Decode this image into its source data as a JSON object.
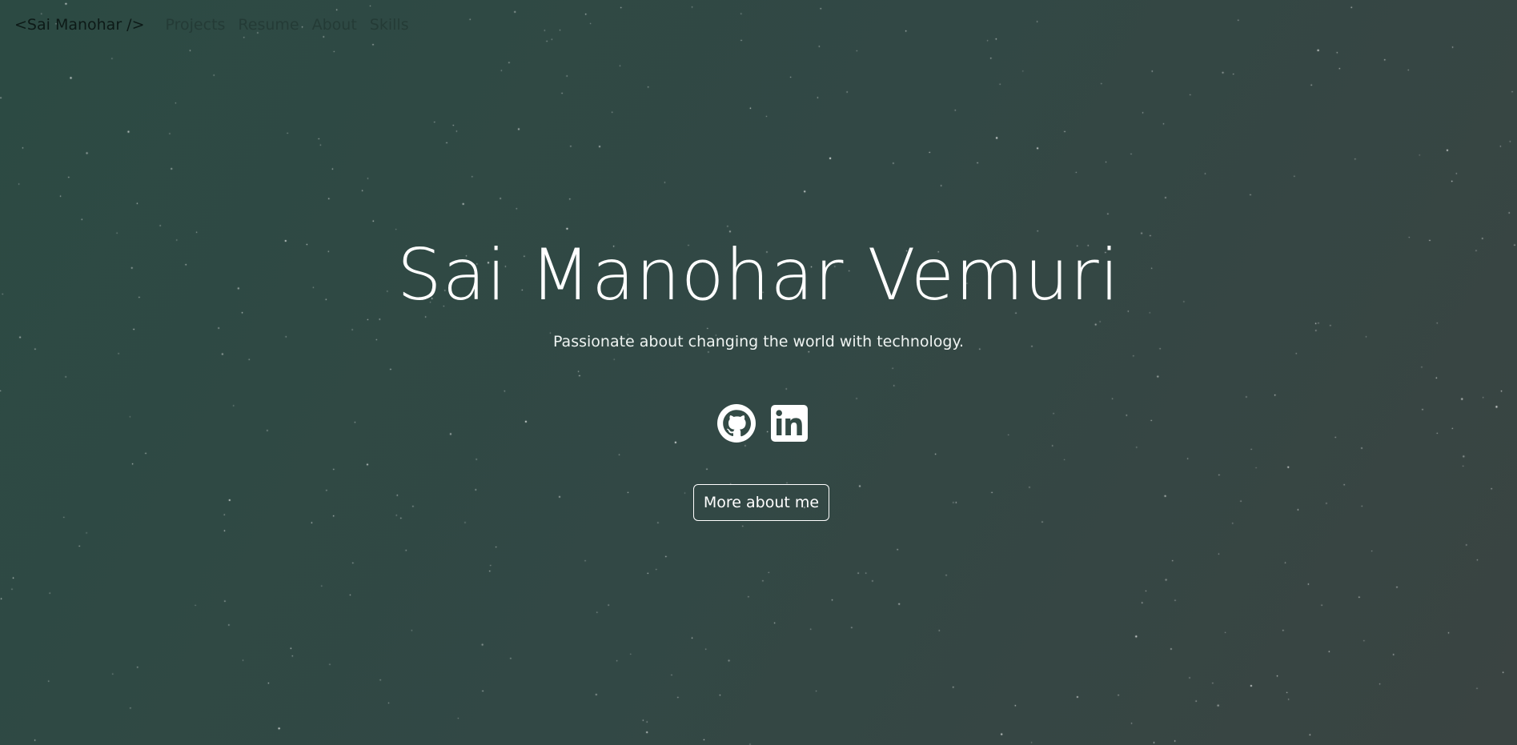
{
  "nav": {
    "brand": "<Sai Manohar />",
    "links": [
      "Projects",
      "Resume",
      "About",
      "Skills"
    ]
  },
  "hero": {
    "title": "Sai Manohar Vemuri",
    "subtitle": "Passionate about changing the world with technology.",
    "cta_label": "More about me"
  },
  "social": {
    "icons": [
      "github-icon",
      "linkedin-icon"
    ]
  },
  "colors": {
    "background_start": "#2c4a43",
    "background_end": "#3a4442",
    "text": "#ffffff",
    "nav_brand": "#0d1a17"
  }
}
